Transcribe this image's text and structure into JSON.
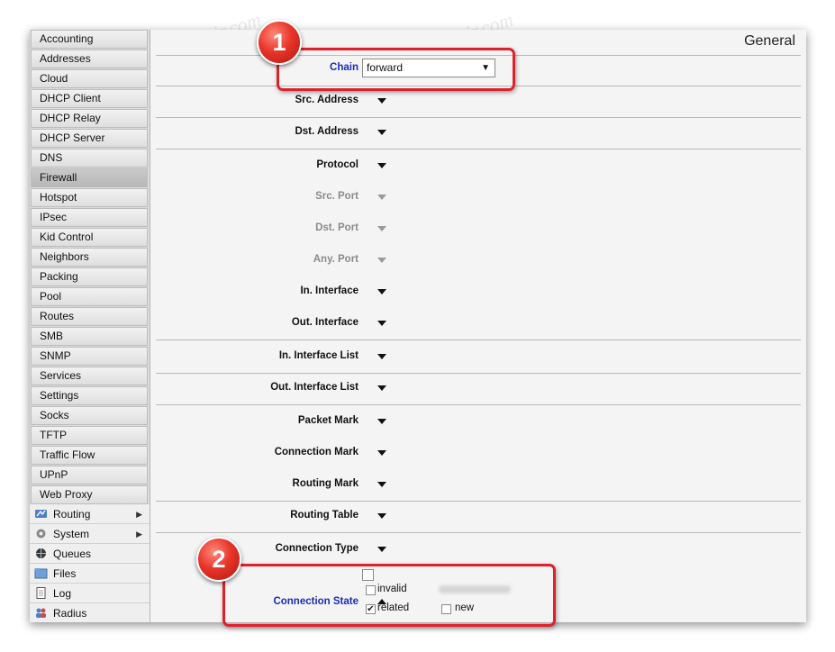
{
  "sidebar": {
    "items": [
      {
        "label": "Accounting"
      },
      {
        "label": "Addresses"
      },
      {
        "label": "Cloud"
      },
      {
        "label": "DHCP Client"
      },
      {
        "label": "DHCP Relay"
      },
      {
        "label": "DHCP Server"
      },
      {
        "label": "DNS"
      },
      {
        "label": "Firewall",
        "selected": true
      },
      {
        "label": "Hotspot"
      },
      {
        "label": "IPsec"
      },
      {
        "label": "Kid Control"
      },
      {
        "label": "Neighbors"
      },
      {
        "label": "Packing"
      },
      {
        "label": "Pool"
      },
      {
        "label": "Routes"
      },
      {
        "label": "SMB"
      },
      {
        "label": "SNMP"
      },
      {
        "label": "Services"
      },
      {
        "label": "Settings"
      },
      {
        "label": "Socks"
      },
      {
        "label": "TFTP"
      },
      {
        "label": "Traffic Flow"
      },
      {
        "label": "UPnP"
      },
      {
        "label": "Web Proxy"
      }
    ],
    "main_menu": [
      {
        "label": "Routing",
        "icon": "routing-icon",
        "has_submenu": true
      },
      {
        "label": "System",
        "icon": "gear-icon",
        "has_submenu": true
      },
      {
        "label": "Queues",
        "icon": "queues-icon",
        "has_submenu": false
      },
      {
        "label": "Files",
        "icon": "folder-icon",
        "has_submenu": false
      },
      {
        "label": "Log",
        "icon": "log-icon",
        "has_submenu": false
      },
      {
        "label": "Radius",
        "icon": "users-icon",
        "has_submenu": false
      }
    ]
  },
  "content": {
    "tab": "General",
    "chain": {
      "label": "Chain",
      "value": "forward"
    },
    "fields": {
      "src_address": "Src. Address",
      "dst_address": "Dst. Address",
      "protocol": "Protocol",
      "src_port": "Src. Port",
      "dst_port": "Dst. Port",
      "any_port": "Any. Port",
      "in_interface": "In. Interface",
      "out_interface": "Out. Interface",
      "in_interface_list": "In. Interface List",
      "out_interface_list": "Out. Interface List",
      "packet_mark": "Packet Mark",
      "connection_mark": "Connection Mark",
      "routing_mark": "Routing Mark",
      "routing_table": "Routing Table",
      "connection_type": "Connection Type",
      "connection_state": "Connection State"
    },
    "connection_state_options": {
      "invalid": {
        "label": "invalid",
        "checked": false
      },
      "related": {
        "label": "related",
        "checked": true
      },
      "new": {
        "label": "new",
        "checked": false
      }
    }
  },
  "annotations": {
    "badge1": "1",
    "badge2": "2",
    "highlight_color": "#e0212b"
  },
  "watermark": "Soringperepair.com"
}
